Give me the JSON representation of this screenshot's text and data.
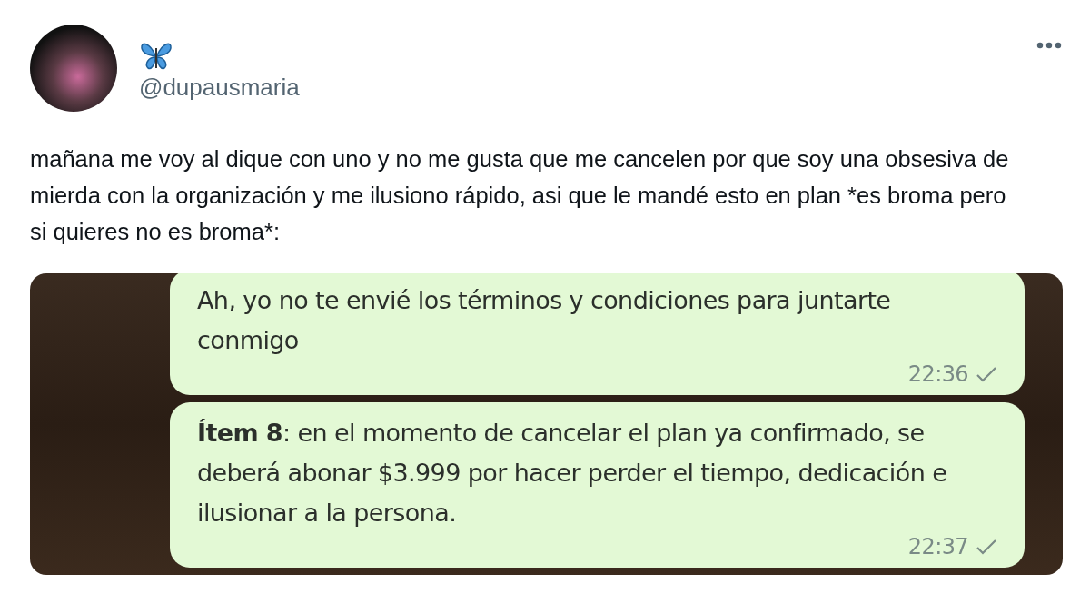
{
  "author": {
    "handle": "@dupausmaria"
  },
  "tweet": {
    "text": "mañana me voy al dique con uno y no me gusta que me cancelen por que soy una obsesiva de mierda con la organización y me ilusiono rápido, asi que le mandé esto en plan *es broma pero si quieres no es broma*:"
  },
  "chat_messages": [
    {
      "text": "Ah, yo no te envié los términos y condiciones para juntarte conmigo",
      "time": "22:36"
    },
    {
      "text": "**Ítem 8**: en el momento de cancelar el plan ya confirmado, se deberá abonar $3.999 por hacer perder el tiempo, dedicación e ilusionar a la persona.",
      "time": "22:37"
    }
  ]
}
